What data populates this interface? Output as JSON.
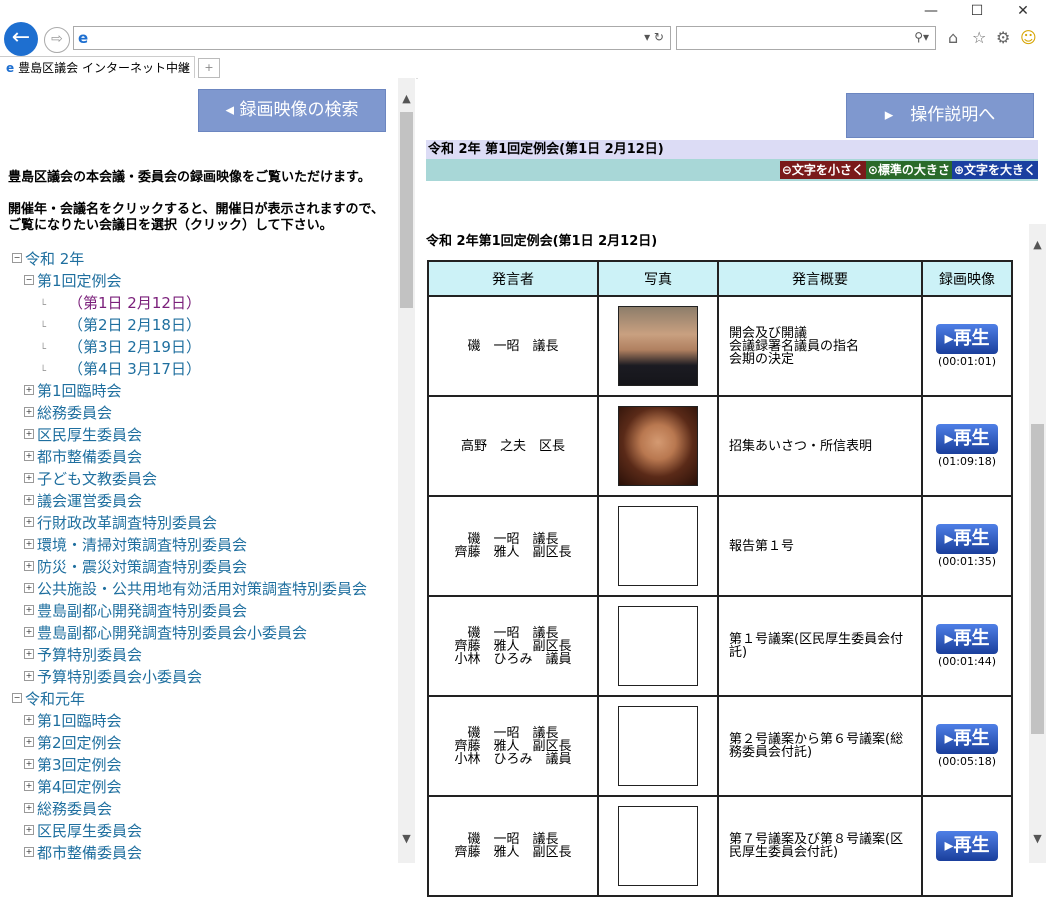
{
  "window": {
    "min_label": "—",
    "max_label": "☐",
    "close_label": "✕"
  },
  "toolbar": {
    "back_icon": "←",
    "forward_icon": "⇨",
    "address_value": "",
    "address_controls": "▾ ↻",
    "search_value": "",
    "search_controls": "⚲▾",
    "home_icon": "⌂",
    "favorites_icon": "☆",
    "settings_icon": "⚙",
    "smile_icon": "☺"
  },
  "tabs": [
    {
      "label": "豊島区議会 インターネット中継",
      "close": "✕"
    }
  ],
  "left": {
    "search_button": "◂ 録画映像の検索",
    "intro_1": "豊島区議会の本会議・委員会の録画映像をご覧いただけます。",
    "intro_2": "開催年・会議名をクリックすると、開催日が表示されますので、",
    "intro_3": "ご覧になりたい会議日を選択（クリック）して下さい。",
    "tree": [
      {
        "level": 0,
        "box": "⊟",
        "label": "令和 2年"
      },
      {
        "level": 1,
        "box": "⊟",
        "label": "第1回定例会"
      },
      {
        "level": 2,
        "leaf": true,
        "label": "（第1日 2月12日）",
        "visited": true
      },
      {
        "level": 2,
        "leaf": true,
        "label": "（第2日 2月18日）"
      },
      {
        "level": 2,
        "leaf": true,
        "label": "（第3日 2月19日）"
      },
      {
        "level": 2,
        "leaf": true,
        "label": "（第4日 3月17日）"
      },
      {
        "level": 1,
        "box": "⊞",
        "label": "第1回臨時会"
      },
      {
        "level": 1,
        "box": "⊞",
        "label": "総務委員会"
      },
      {
        "level": 1,
        "box": "⊞",
        "label": "区民厚生委員会"
      },
      {
        "level": 1,
        "box": "⊞",
        "label": "都市整備委員会"
      },
      {
        "level": 1,
        "box": "⊞",
        "label": "子ども文教委員会"
      },
      {
        "level": 1,
        "box": "⊞",
        "label": "議会運営委員会"
      },
      {
        "level": 1,
        "box": "⊞",
        "label": "行財政改革調査特別委員会"
      },
      {
        "level": 1,
        "box": "⊞",
        "label": "環境・清掃対策調査特別委員会"
      },
      {
        "level": 1,
        "box": "⊞",
        "label": "防災・震災対策調査特別委員会"
      },
      {
        "level": 1,
        "box": "⊞",
        "label": "公共施設・公共用地有効活用対策調査特別委員会"
      },
      {
        "level": 1,
        "box": "⊞",
        "label": "豊島副都心開発調査特別委員会"
      },
      {
        "level": 1,
        "box": "⊞",
        "label": "豊島副都心開発調査特別委員会小委員会"
      },
      {
        "level": 1,
        "box": "⊞",
        "label": "予算特別委員会"
      },
      {
        "level": 1,
        "box": "⊞",
        "label": "予算特別委員会小委員会"
      },
      {
        "level": 0,
        "box": "⊟",
        "label": "令和元年"
      },
      {
        "level": 1,
        "box": "⊞",
        "label": "第1回臨時会"
      },
      {
        "level": 1,
        "box": "⊞",
        "label": "第2回定例会"
      },
      {
        "level": 1,
        "box": "⊞",
        "label": "第3回定例会"
      },
      {
        "level": 1,
        "box": "⊞",
        "label": "第4回定例会"
      },
      {
        "level": 1,
        "box": "⊞",
        "label": "総務委員会"
      },
      {
        "level": 1,
        "box": "⊞",
        "label": "区民厚生委員会"
      },
      {
        "level": 1,
        "box": "⊞",
        "label": "都市整備委員会"
      }
    ]
  },
  "right": {
    "help_button": "▸　操作説明へ",
    "session_bar": "令和 2年 第1回定例会(第1日 2月12日)",
    "font_small": "⊖文字を小さく",
    "font_normal": "⊙標準の大きさ",
    "font_large": "⊕文字を大きく",
    "main_title": "令和 2年第1回定例会(第1日 2月12日)",
    "table": {
      "headers": [
        "発言者",
        "写真",
        "発言概要",
        "録画映像"
      ],
      "play_label": "▸再生",
      "rows": [
        {
          "speaker": "磯　一昭　議長",
          "photo": "p1",
          "summary": "開会及び開議\n会議録署名議員の指名\n会期の決定",
          "time": "(00:01:01)"
        },
        {
          "speaker": "高野　之夫　区長",
          "photo": "p2",
          "summary": "招集あいさつ・所信表明",
          "time": "(01:09:18)"
        },
        {
          "speaker": "磯　一昭　議長\n齊藤　雅人　副区長",
          "photo": "",
          "summary": "報告第１号",
          "time": "(00:01:35)"
        },
        {
          "speaker": "磯　一昭　議長\n齊藤　雅人　副区長\n小林　ひろみ　議員",
          "photo": "",
          "summary": "第１号議案(区民厚生委員会付\n託)",
          "time": "(00:01:44)"
        },
        {
          "speaker": "磯　一昭　議長\n齊藤　雅人　副区長\n小林　ひろみ　議員",
          "photo": "",
          "summary": "第２号議案から第６号議案(総\n務委員会付託)",
          "time": "(00:05:18)"
        },
        {
          "speaker": "磯　一昭　議長\n齊藤　雅人　副区長",
          "photo": "",
          "summary": "第７号議案及び第８号議案(区\n民厚生委員会付託)",
          "time": ""
        }
      ]
    }
  }
}
